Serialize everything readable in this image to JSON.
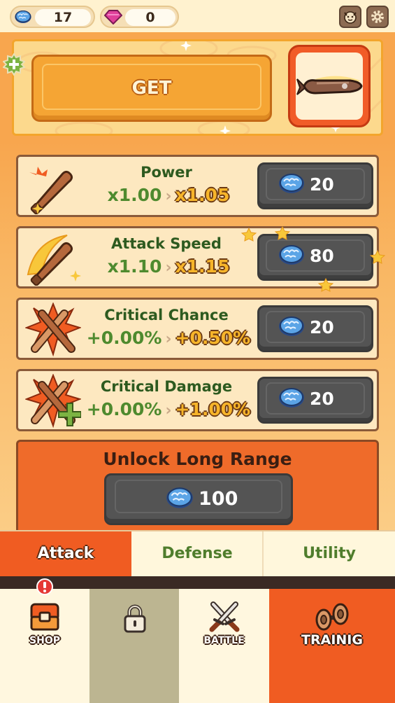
{
  "resources": {
    "bottlecaps": {
      "icon": "bottlecap-icon",
      "value": "17"
    },
    "gems": {
      "icon": "pink-gem-icon",
      "value": "0"
    }
  },
  "header_buttons": [
    {
      "name": "profile-bulldog-icon"
    },
    {
      "name": "settings-gear-icon"
    }
  ],
  "offer": {
    "button_label": "GET",
    "reward_icon": "rocket-icon"
  },
  "upgrades": [
    {
      "title": "Power",
      "current": "x1.00",
      "next": "x1.05",
      "cost": "20",
      "icon": "bat-icon"
    },
    {
      "title": "Attack Speed",
      "current": "x1.10",
      "next": "x1.15",
      "cost": "80",
      "icon": "speed-bat-icon"
    },
    {
      "title": "Critical Chance",
      "current": "+0.00%",
      "next": "+0.50%",
      "cost": "20",
      "icon": "crossed-bats-icon"
    },
    {
      "title": "Critical Damage",
      "current": "+0.00%",
      "next": "+1.00%",
      "cost": "20",
      "icon": "crossed-bats-plus-icon"
    }
  ],
  "unlock": {
    "title": "Unlock Long Range",
    "cost": "100"
  },
  "category_tabs": [
    {
      "label": "Attack",
      "active": true
    },
    {
      "label": "Defense",
      "active": false
    },
    {
      "label": "Utility",
      "active": false
    }
  ],
  "nav": [
    {
      "label": "SHOP",
      "icon": "shop-chest-icon",
      "alert": "!"
    },
    {
      "label": "",
      "icon": "lock-icon"
    },
    {
      "label": "BATTLE",
      "icon": "crossed-knives-icon"
    },
    {
      "label": "TRAINIG",
      "icon": "dumbbell-icon",
      "active": true
    }
  ],
  "colors": {
    "accent_orange": "#f05c22",
    "active_value": "#f7b52a",
    "title_green": "#2d5a1f",
    "button_gray": "#545454"
  }
}
